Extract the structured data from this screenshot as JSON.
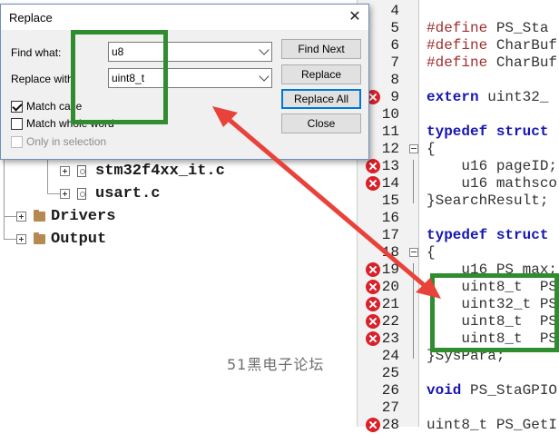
{
  "dialog": {
    "title": "Replace",
    "find_label": "Find what:",
    "find_value": "u8",
    "replace_label": "Replace with",
    "replace_value": "uint8_t",
    "find_next_button": "Find Next",
    "replace_button": "Replace",
    "replace_all_button": "Replace All",
    "close_button": "Close",
    "match_case": {
      "label": "Match case",
      "checked": true
    },
    "match_whole_word": {
      "label": "Match whole word",
      "checked": false
    },
    "only_in_selection": {
      "label": "Only in selection",
      "checked": false,
      "enabled": false
    }
  },
  "tree": {
    "items": [
      {
        "label": "stm32f4xx_it.c",
        "type": "file"
      },
      {
        "label": "usart.c",
        "type": "file"
      },
      {
        "label": "Drivers",
        "type": "folder"
      },
      {
        "label": "Output",
        "type": "folder"
      }
    ]
  },
  "editor": {
    "lines": [
      {
        "num": "4",
        "error": false,
        "text": ""
      },
      {
        "num": "5",
        "error": false,
        "text": "#define PS_Sta"
      },
      {
        "num": "6",
        "error": false,
        "text": "#define CharBuf"
      },
      {
        "num": "7",
        "error": false,
        "text": "#define CharBuf"
      },
      {
        "num": "8",
        "error": false,
        "text": ""
      },
      {
        "num": "9",
        "error": true,
        "text": "extern uint32_"
      },
      {
        "num": "10",
        "error": false,
        "text": ""
      },
      {
        "num": "11",
        "error": false,
        "text": "typedef struct"
      },
      {
        "num": "12",
        "error": false,
        "text": "{"
      },
      {
        "num": "13",
        "error": true,
        "text": "    u16 pageID;"
      },
      {
        "num": "14",
        "error": true,
        "text": "    u16 mathsco"
      },
      {
        "num": "15",
        "error": false,
        "text": "}SearchResult;"
      },
      {
        "num": "16",
        "error": false,
        "text": ""
      },
      {
        "num": "17",
        "error": false,
        "text": "typedef struct"
      },
      {
        "num": "18",
        "error": false,
        "text": "{"
      },
      {
        "num": "19",
        "error": true,
        "text": "    u16 PS_max;"
      },
      {
        "num": "20",
        "error": true,
        "text": "    uint8_t  PS"
      },
      {
        "num": "21",
        "error": true,
        "text": "    uint32_t PS"
      },
      {
        "num": "22",
        "error": true,
        "text": "    uint8_t  PS"
      },
      {
        "num": "23",
        "error": true,
        "text": "    uint8_t  PS"
      },
      {
        "num": "24",
        "error": false,
        "text": "}SysPara;"
      },
      {
        "num": "25",
        "error": false,
        "text": ""
      },
      {
        "num": "26",
        "error": false,
        "text": "void PS_StaGPIO"
      },
      {
        "num": "27",
        "error": false,
        "text": ""
      },
      {
        "num": "28",
        "error": true,
        "text": "uint8_t PS_GetI"
      }
    ]
  },
  "watermark": "51黑电子论坛",
  "colors": {
    "highlight_box": "#2f8d2f",
    "arrow": "#e8423a",
    "error_icon": "#d8212b",
    "keyword": "#1717b3"
  }
}
